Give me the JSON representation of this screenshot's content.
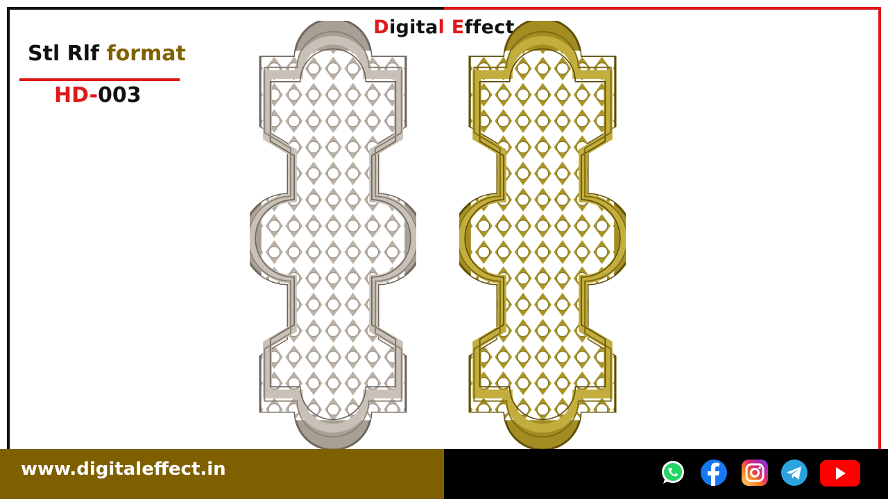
{
  "header": {
    "brand_first_letter": "D",
    "brand_rest_1": "igita",
    "brand_mid_letter": "l",
    "brand_space": " ",
    "brand_second_letter": "E",
    "brand_rest_2": "ffect"
  },
  "product": {
    "format_prefix": "Stl Rlf",
    "format_word": "format",
    "code_prefix": "HD-",
    "code_number": "003"
  },
  "footer": {
    "website": "www.digitaleffect.in"
  },
  "social_icons": [
    "whatsapp-icon",
    "facebook-icon",
    "instagram-icon",
    "telegram-icon",
    "youtube-icon"
  ],
  "colors": {
    "accent_red": "#e01818",
    "brand_gold": "#7f6000",
    "panel_grey": "#a89f95",
    "panel_gold": "#a38c22"
  }
}
